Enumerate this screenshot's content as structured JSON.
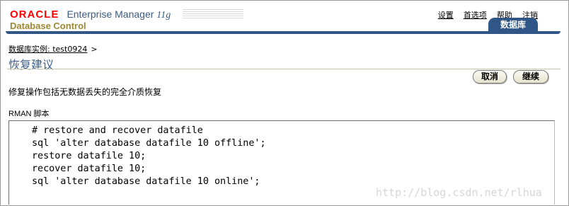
{
  "header": {
    "brand_oracle": "ORACLE",
    "brand_product": "Enterprise Manager",
    "brand_version": "11g",
    "subtitle": "Database Control",
    "global_links": [
      "设置",
      "首选项",
      "帮助",
      "注销"
    ],
    "active_tab": "数据库"
  },
  "breadcrumb": {
    "link": "数据库实例: test0924",
    "separator": ">"
  },
  "page": {
    "title": "恢复建议",
    "description": "修复操作包括无数据丢失的完全介质恢复"
  },
  "buttons": {
    "cancel": "取消",
    "continue": "继续"
  },
  "rman": {
    "label": "RMAN 脚本",
    "lines": [
      "# restore and recover datafile",
      "sql 'alter database datafile 10 offline';",
      "restore datafile 10;",
      "recover datafile 10;",
      "sql 'alter database datafile 10 online';"
    ]
  },
  "watermark": "http://blog.csdn.net/rlhua",
  "colors": {
    "oracle_red": "#ff0000",
    "brand_blue": "#2f5687",
    "title_blue": "#3d5f8f",
    "subtitle_gold": "#9b8a33"
  }
}
